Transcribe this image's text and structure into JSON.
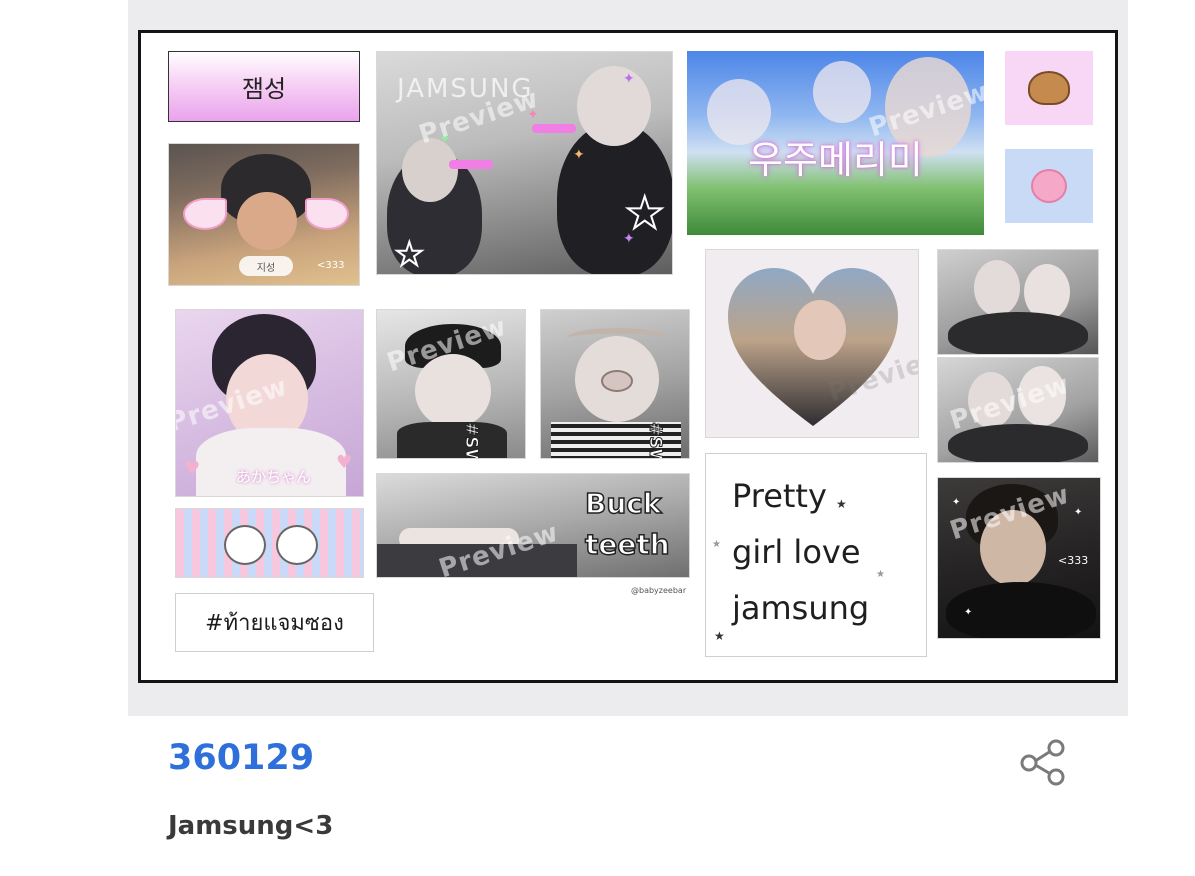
{
  "sticker_sheet": {
    "watermark": "Preview",
    "jamsung_label": "잼성",
    "jamsung_photo_text": "JAMSUNG",
    "uju_text": "우주메리미",
    "kid_tag": "지성",
    "kid_heart_text": "<333",
    "akachan_text": "あかちゃん",
    "swag_1": "#SWAG",
    "swag_2": "#SWAG",
    "buck_line1": "Buck",
    "buck_line2": "teeth",
    "credit": "@babyzeebar",
    "pretty_line1": "Pretty",
    "pretty_line2": "girl love",
    "pretty_line3": "jamsung",
    "thai_tag": "#ท้ายแจมซอง",
    "photo_heart_text": "<333"
  },
  "listing": {
    "title": "360129",
    "description": "Jamsung<3"
  },
  "icons": {
    "share": "share-icon"
  },
  "colors": {
    "title_blue": "#2f6fd9",
    "pink_label": "#f0a8ec"
  }
}
